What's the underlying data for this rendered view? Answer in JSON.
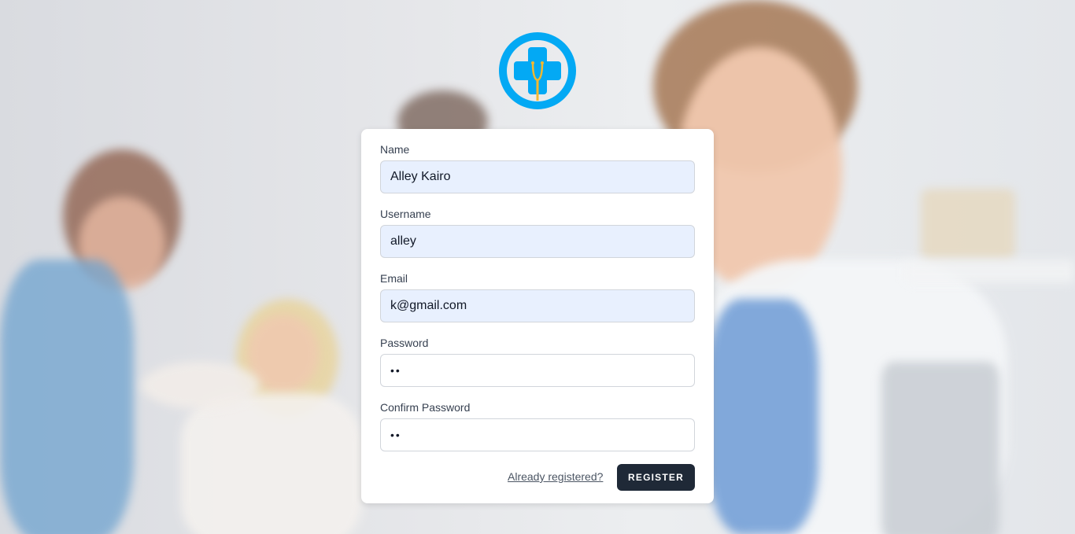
{
  "brand": {
    "logo_icon": "medical-cross-stethoscope-icon",
    "colors": {
      "logo_blue": "#03a9f4",
      "stethoscope_gold": "#f5b82e"
    }
  },
  "form": {
    "name": {
      "label": "Name",
      "value": "Alley Kairo"
    },
    "username": {
      "label": "Username",
      "value": "alley"
    },
    "email": {
      "label": "Email",
      "value": "k@gmail.com"
    },
    "password": {
      "label": "Password",
      "value": "••"
    },
    "confirm_password": {
      "label": "Confirm Password",
      "value": "••"
    },
    "already_registered_link": "Already registered?",
    "register_button": "REGISTER"
  },
  "colors": {
    "button_bg": "#1f2937",
    "autofill_bg": "#e8f0fe"
  }
}
